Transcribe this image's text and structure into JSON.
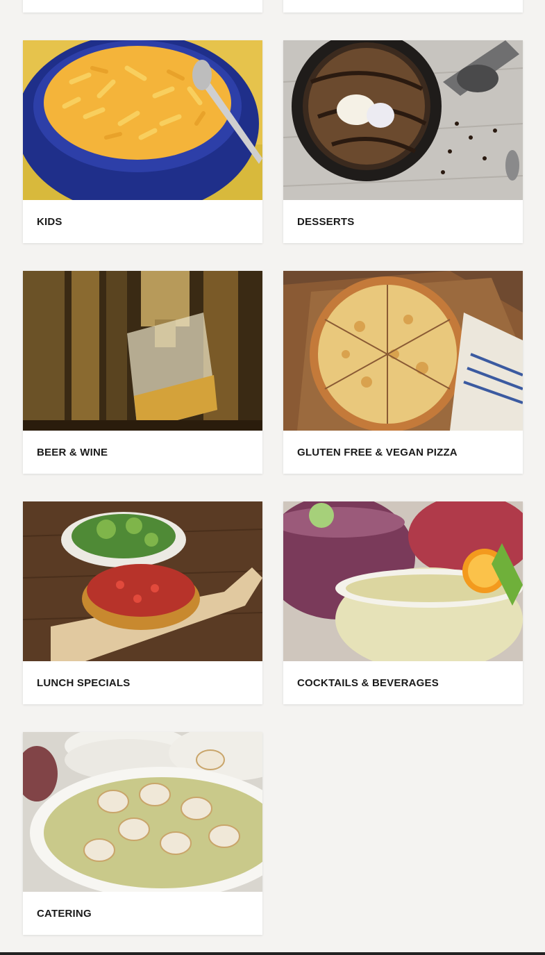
{
  "menu": {
    "categories": [
      {
        "label": "",
        "image": "partial-card"
      },
      {
        "label": "",
        "image": "partial-card"
      },
      {
        "label": "KIDS",
        "image": "mac-and-cheese-photo"
      },
      {
        "label": "DESSERTS",
        "image": "skillet-cookie-photo"
      },
      {
        "label": "BEER & WINE",
        "image": "beer-tap-photo"
      },
      {
        "label": "GLUTEN FREE & VEGAN PIZZA",
        "image": "cheese-pizza-photo"
      },
      {
        "label": "LUNCH SPECIALS",
        "image": "deep-dish-salad-photo"
      },
      {
        "label": "COCKTAILS & BEVERAGES",
        "image": "margarita-photo"
      },
      {
        "label": "CATERING",
        "image": "catering-pasta-photo"
      }
    ]
  },
  "colors": {
    "page_background": "#f4f3f1",
    "card_background": "#ffffff",
    "label_text": "#1a1a1a"
  }
}
